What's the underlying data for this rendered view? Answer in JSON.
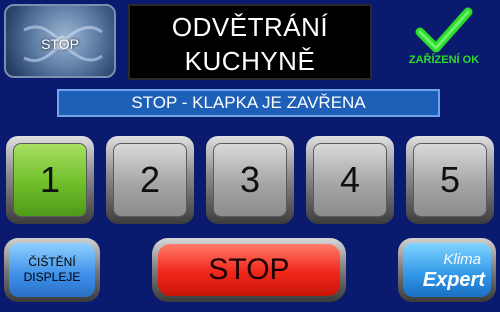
{
  "fan": {
    "label": "STOP",
    "icon": "fan-icon"
  },
  "title": {
    "line1": "ODVĚTRÁNÍ",
    "line2": "KUCHYNĚ"
  },
  "status": {
    "icon": "checkmark-icon",
    "text": "ZAŘÍZENÍ OK",
    "color": "#2bdc2b"
  },
  "message": "STOP - KLAPKA JE ZAVŘENA",
  "speeds": [
    {
      "label": "1",
      "active": true
    },
    {
      "label": "2",
      "active": false
    },
    {
      "label": "3",
      "active": false
    },
    {
      "label": "4",
      "active": false
    },
    {
      "label": "5",
      "active": false
    }
  ],
  "clean_button": {
    "line1": "ČIŠTĚNÍ",
    "line2": "DISPLEJE"
  },
  "stop_button": {
    "label": "STOP"
  },
  "logo": {
    "line1": "Klima",
    "line2": "Expert"
  },
  "colors": {
    "background": "#0a1a6e",
    "message_bg": "#1e5fb8",
    "active_speed": "#6fbf2a",
    "stop": "#f0261a"
  }
}
